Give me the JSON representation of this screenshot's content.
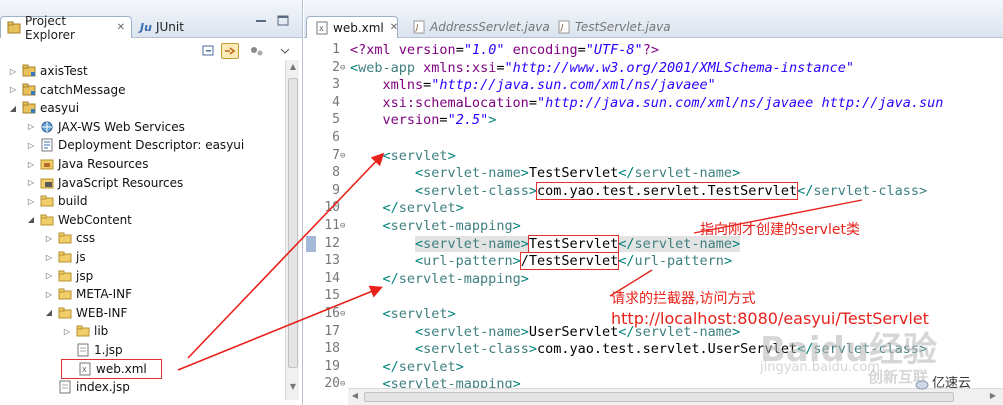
{
  "left_panel": {
    "tabs": [
      {
        "label": "Project Explorer",
        "icon": "project-explorer-icon",
        "active": true
      },
      {
        "label": "JUnit",
        "icon": "junit-icon",
        "prefix": "Ju",
        "active": false
      }
    ],
    "tree": [
      {
        "label": "axisTest",
        "indent": 0,
        "twisty": "collapsed",
        "icon": "project-icon"
      },
      {
        "label": "catchMessage",
        "indent": 0,
        "twisty": "collapsed",
        "icon": "project-icon"
      },
      {
        "label": "easyui",
        "indent": 0,
        "twisty": "expanded",
        "icon": "project-icon"
      },
      {
        "label": "JAX-WS Web Services",
        "indent": 1,
        "twisty": "collapsed",
        "icon": "webservices-icon"
      },
      {
        "label": "Deployment Descriptor: easyui",
        "indent": 1,
        "twisty": "collapsed",
        "icon": "descriptor-icon"
      },
      {
        "label": "Java Resources",
        "indent": 1,
        "twisty": "collapsed",
        "icon": "java-resources-icon"
      },
      {
        "label": "JavaScript Resources",
        "indent": 1,
        "twisty": "collapsed",
        "icon": "javascript-resources-icon"
      },
      {
        "label": "build",
        "indent": 1,
        "twisty": "collapsed",
        "icon": "folder-icon"
      },
      {
        "label": "WebContent",
        "indent": 1,
        "twisty": "expanded",
        "icon": "folder-icon"
      },
      {
        "label": "css",
        "indent": 2,
        "twisty": "collapsed",
        "icon": "folder-icon"
      },
      {
        "label": "js",
        "indent": 2,
        "twisty": "collapsed",
        "icon": "folder-icon"
      },
      {
        "label": "jsp",
        "indent": 2,
        "twisty": "collapsed",
        "icon": "folder-icon"
      },
      {
        "label": "META-INF",
        "indent": 2,
        "twisty": "collapsed",
        "icon": "folder-icon"
      },
      {
        "label": "WEB-INF",
        "indent": 2,
        "twisty": "expanded",
        "icon": "folder-icon"
      },
      {
        "label": "lib",
        "indent": 3,
        "twisty": "collapsed",
        "icon": "folder-icon"
      },
      {
        "label": "1.jsp",
        "indent": 3,
        "twisty": "none",
        "icon": "jsp-file-icon"
      },
      {
        "label": "web.xml",
        "indent": 3,
        "twisty": "none",
        "icon": "xml-file-icon",
        "selected": true
      },
      {
        "label": "index.jsp",
        "indent": 2,
        "twisty": "none",
        "icon": "jsp-file-icon"
      }
    ]
  },
  "editor": {
    "tabs": [
      {
        "label": "web.xml",
        "icon": "xml-file-icon",
        "active": true
      },
      {
        "label": "AddressServlet.java",
        "icon": "java-file-icon",
        "active": false
      },
      {
        "label": "TestServlet.java",
        "icon": "java-file-icon",
        "active": false
      }
    ],
    "lines": [
      {
        "n": "1",
        "fold": "",
        "segs": [
          [
            "t-pi",
            "<?xml "
          ],
          [
            "t-attr",
            "version"
          ],
          [
            "t-txt",
            "="
          ],
          [
            "t-val",
            "\"1.0\""
          ],
          [
            "t-txt",
            " "
          ],
          [
            "t-attr",
            "encoding"
          ],
          [
            "t-txt",
            "="
          ],
          [
            "t-val",
            "\"UTF-8\""
          ],
          [
            "t-pi",
            "?>"
          ]
        ]
      },
      {
        "n": "2",
        "fold": "⊖",
        "segs": [
          [
            "t-bracket",
            "<"
          ],
          [
            "t-tag",
            "web-app "
          ],
          [
            "t-attr",
            "xmlns:xsi"
          ],
          [
            "t-txt",
            "="
          ],
          [
            "t-val",
            "\"http://www.w3.org/2001/XMLSchema-instance\""
          ]
        ]
      },
      {
        "n": "3",
        "fold": "",
        "segs": [
          [
            "t-txt",
            "    "
          ],
          [
            "t-attr",
            "xmlns"
          ],
          [
            "t-txt",
            "="
          ],
          [
            "t-val",
            "\"http://java.sun.com/xml/ns/javaee\""
          ]
        ]
      },
      {
        "n": "4",
        "fold": "",
        "segs": [
          [
            "t-txt",
            "    "
          ],
          [
            "t-attr",
            "xsi:schemaLocation"
          ],
          [
            "t-txt",
            "="
          ],
          [
            "t-val",
            "\"http://java.sun.com/xml/ns/javaee http://java.sun"
          ]
        ]
      },
      {
        "n": "5",
        "fold": "",
        "segs": [
          [
            "t-txt",
            "    "
          ],
          [
            "t-attr",
            "version"
          ],
          [
            "t-txt",
            "="
          ],
          [
            "t-val",
            "\"2.5\""
          ],
          [
            "t-bracket",
            ">"
          ]
        ]
      },
      {
        "n": "6",
        "fold": "",
        "segs": []
      },
      {
        "n": "7",
        "fold": "⊖",
        "segs": [
          [
            "t-txt",
            "    "
          ],
          [
            "t-bracket",
            "<"
          ],
          [
            "t-tag",
            "servlet"
          ],
          [
            "t-bracket",
            ">"
          ]
        ]
      },
      {
        "n": "8",
        "fold": "",
        "segs": [
          [
            "t-txt",
            "        "
          ],
          [
            "t-bracket",
            "<"
          ],
          [
            "t-tag",
            "servlet-name"
          ],
          [
            "t-bracket",
            ">"
          ],
          [
            "t-txt",
            "TestServlet"
          ],
          [
            "t-bracket",
            "</"
          ],
          [
            "t-tag",
            "servlet-name"
          ],
          [
            "t-bracket",
            ">"
          ]
        ]
      },
      {
        "n": "9",
        "fold": "",
        "segs": [
          [
            "t-txt",
            "        "
          ],
          [
            "t-bracket",
            "<"
          ],
          [
            "t-tag",
            "servlet-class"
          ],
          [
            "t-bracket",
            ">"
          ],
          [
            "t-txt hl-box",
            "com.yao.test.servlet.TestServlet"
          ],
          [
            "t-bracket",
            "</"
          ],
          [
            "t-tag",
            "servlet-class>"
          ]
        ]
      },
      {
        "n": "10",
        "fold": "",
        "segs": [
          [
            "t-txt",
            "    "
          ],
          [
            "t-bracket",
            "</"
          ],
          [
            "t-tag",
            "servlet"
          ],
          [
            "t-bracket",
            ">"
          ]
        ]
      },
      {
        "n": "11",
        "fold": "⊖",
        "segs": [
          [
            "t-txt",
            "    "
          ],
          [
            "t-bracket",
            "<"
          ],
          [
            "t-tag",
            "servlet-mapping"
          ],
          [
            "t-bracket",
            ">"
          ]
        ]
      },
      {
        "n": "12",
        "fold": "",
        "segs": [
          [
            "t-txt",
            "        "
          ],
          [
            "t-bracket occ",
            "<"
          ],
          [
            "t-tag occ",
            "servlet-name"
          ],
          [
            "t-bracket occ",
            ">"
          ],
          [
            "t-txt hl-box",
            "TestServlet"
          ],
          [
            "t-bracket occ",
            "</"
          ],
          [
            "t-tag occ",
            "servlet-name"
          ],
          [
            "t-bracket occ",
            ">"
          ]
        ]
      },
      {
        "n": "13",
        "fold": "",
        "segs": [
          [
            "t-txt",
            "        "
          ],
          [
            "t-bracket",
            "<"
          ],
          [
            "t-tag",
            "url-pattern"
          ],
          [
            "t-bracket",
            ">"
          ],
          [
            "t-txt hl-box",
            "/TestServlet"
          ],
          [
            "t-bracket",
            "</"
          ],
          [
            "t-tag",
            "url-pattern"
          ],
          [
            "t-bracket",
            ">"
          ]
        ]
      },
      {
        "n": "14",
        "fold": "",
        "segs": [
          [
            "t-txt",
            "    "
          ],
          [
            "t-bracket",
            "</"
          ],
          [
            "t-tag",
            "servlet-mapping"
          ],
          [
            "t-bracket",
            ">"
          ]
        ]
      },
      {
        "n": "15",
        "fold": "",
        "segs": []
      },
      {
        "n": "16",
        "fold": "⊖",
        "segs": [
          [
            "t-txt",
            "    "
          ],
          [
            "t-bracket",
            "<"
          ],
          [
            "t-tag",
            "servlet"
          ],
          [
            "t-bracket",
            ">"
          ]
        ]
      },
      {
        "n": "17",
        "fold": "",
        "segs": [
          [
            "t-txt",
            "        "
          ],
          [
            "t-bracket",
            "<"
          ],
          [
            "t-tag",
            "servlet-name"
          ],
          [
            "t-bracket",
            ">"
          ],
          [
            "t-txt",
            "UserServlet"
          ],
          [
            "t-bracket",
            "</"
          ],
          [
            "t-tag",
            "servlet-name"
          ],
          [
            "t-bracket",
            ">"
          ]
        ]
      },
      {
        "n": "18",
        "fold": "",
        "segs": [
          [
            "t-txt",
            "        "
          ],
          [
            "t-bracket",
            "<"
          ],
          [
            "t-tag",
            "servlet-class"
          ],
          [
            "t-bracket",
            ">"
          ],
          [
            "t-txt",
            "com.yao.test.servlet.UserServlet"
          ],
          [
            "t-bracket",
            "</"
          ],
          [
            "t-tag",
            "servlet-class>"
          ]
        ]
      },
      {
        "n": "19",
        "fold": "",
        "segs": [
          [
            "t-txt",
            "    "
          ],
          [
            "t-bracket",
            "</"
          ],
          [
            "t-tag",
            "servlet"
          ],
          [
            "t-bracket",
            ">"
          ]
        ]
      },
      {
        "n": "20",
        "fold": "⊖",
        "segs": [
          [
            "t-txt",
            "    "
          ],
          [
            "t-bracket",
            "<"
          ],
          [
            "t-tag",
            "servlet-mapping"
          ],
          [
            "t-bracket",
            ">"
          ]
        ]
      }
    ]
  },
  "annotations": {
    "class_note": "指向刚才创建的servlet类",
    "request_note": "请求的拦截器,访问方式",
    "url_note": "http://localhost:8080/easyui/TestServlet"
  },
  "watermarks": {
    "baidu": "Baidu经验",
    "jingyan": "jingyan.baidu.com",
    "chuangxin": "创新互联"
  },
  "brand": "亿速云",
  "colors": {
    "annotation_red": "#e8211a",
    "tag_teal": "#3f7f7f",
    "attr_purple": "#7f007f",
    "value_blue": "#2a00ff"
  }
}
